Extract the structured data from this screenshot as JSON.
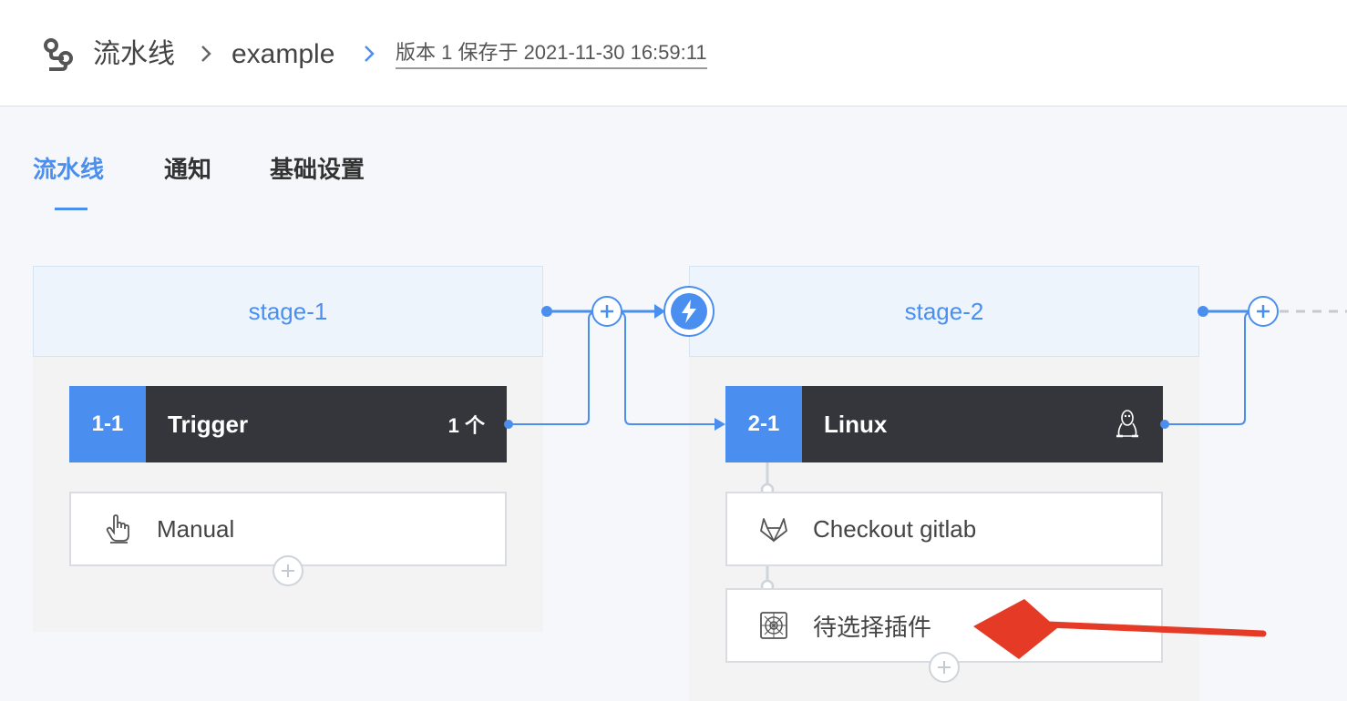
{
  "header": {
    "pipeline_label": "流水线",
    "pipeline_name": "example",
    "version_info": "版本 1 保存于 2021-11-30 16:59:11"
  },
  "tabs": [
    {
      "label": "流水线",
      "active": true
    },
    {
      "label": "通知",
      "active": false
    },
    {
      "label": "基础设置",
      "active": false
    }
  ],
  "stages": [
    {
      "name": "stage-1",
      "job": {
        "id": "1-1",
        "name": "Trigger",
        "extra": "1 个"
      },
      "plugins": [
        {
          "label": "Manual",
          "icon": "hand-pointer-icon"
        }
      ]
    },
    {
      "name": "stage-2",
      "job": {
        "id": "2-1",
        "name": "Linux",
        "extra_icon": "linux-icon"
      },
      "plugins": [
        {
          "label": "Checkout gitlab",
          "icon": "gitlab-icon"
        },
        {
          "label": "待选择插件",
          "icon": "plugin-placeholder-icon"
        }
      ]
    }
  ],
  "colors": {
    "accent": "#4a8ff0",
    "job_dark": "#35363c",
    "arrow_red": "#e43a26"
  }
}
